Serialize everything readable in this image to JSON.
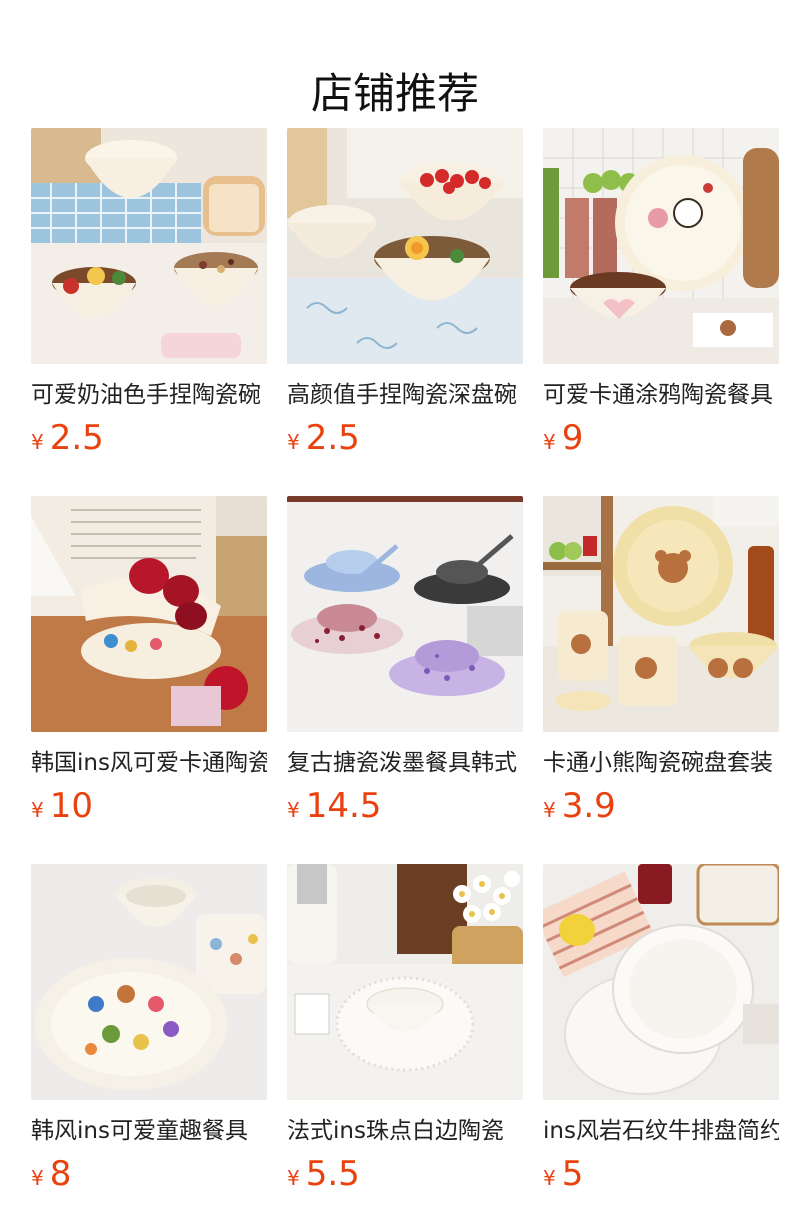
{
  "section": {
    "title": "店铺推荐"
  },
  "currency_symbol": "¥",
  "colors": {
    "price": "#e8420f",
    "title": "#111111",
    "text": "#222222"
  },
  "products": [
    {
      "name": "可爱奶油色手捏陶瓷碗",
      "price": "2.5",
      "image": "bowls-with-noodles-and-cereal"
    },
    {
      "name": "高颜值手捏陶瓷深盘碗",
      "price": "2.5",
      "image": "bowls-with-strawberries-and-noodles"
    },
    {
      "name": "可爱卡通涂鸦陶瓷餐具",
      "price": "9",
      "image": "cartoon-plate-and-bowl"
    },
    {
      "name": "韩国ins风可爱卡通陶瓷",
      "price": "10",
      "image": "cartoon-baking-dish-with-apples"
    },
    {
      "name": "复古搪瓷泼墨餐具韩式",
      "price": "14.5",
      "image": "speckled-enamel-tableware"
    },
    {
      "name": "卡通小熊陶瓷碗盘套装",
      "price": "3.9",
      "image": "bear-mugs-and-plate"
    },
    {
      "name": "韩风ins可爱童趣餐具",
      "price": "8",
      "image": "doodle-oval-plate-and-mug"
    },
    {
      "name": "法式ins珠点白边陶瓷",
      "price": "5.5",
      "image": "beaded-white-plate-and-bowl"
    },
    {
      "name": "ins风岩石纹牛排盘简约",
      "price": "5",
      "image": "rock-texture-white-plates"
    }
  ]
}
